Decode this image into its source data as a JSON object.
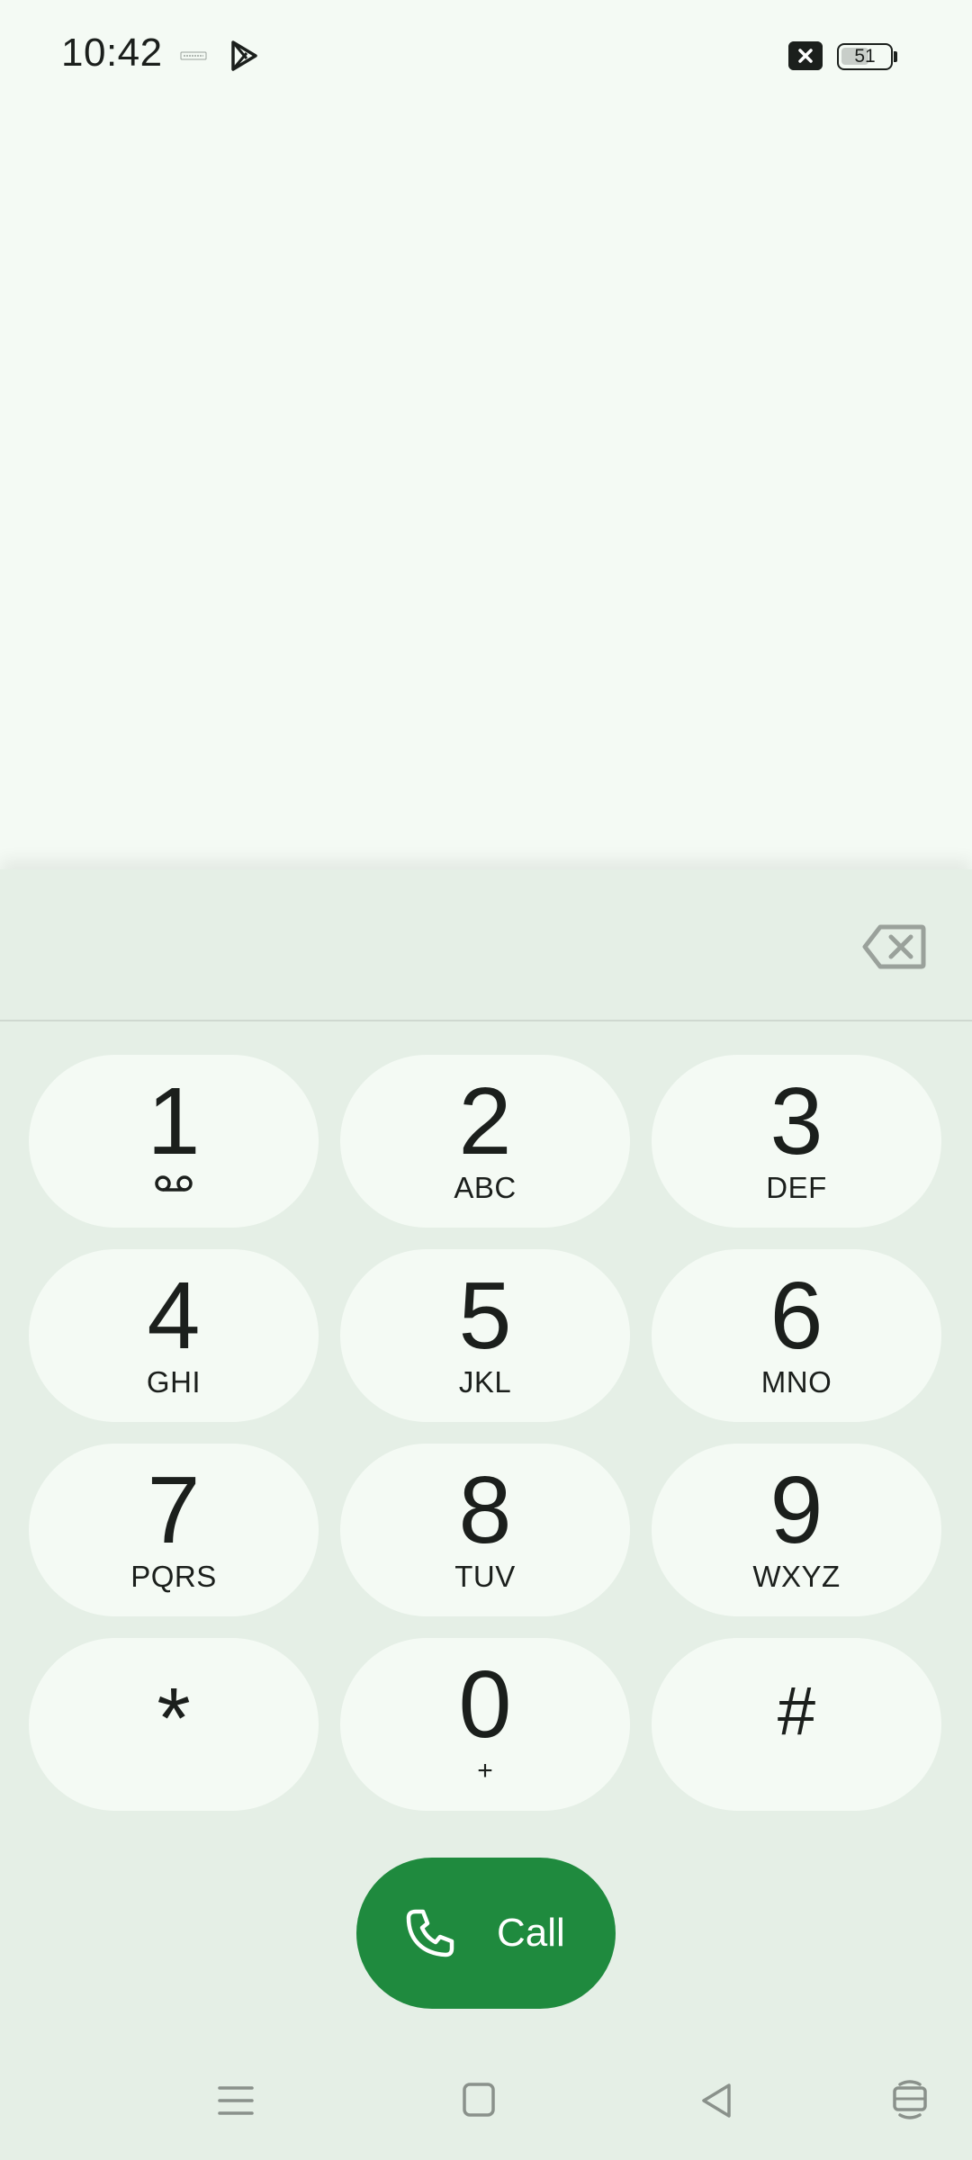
{
  "status_bar": {
    "time": "10:42",
    "battery_level": "51",
    "icons": [
      "notification-icon",
      "play-store-icon",
      "close-badge-icon",
      "battery-icon"
    ]
  },
  "dialer": {
    "digits": "",
    "backspace_icon": "backspace-icon"
  },
  "keypad": {
    "keys": [
      {
        "digit": "1",
        "letters": "",
        "icon": "voicemail-icon"
      },
      {
        "digit": "2",
        "letters": "ABC"
      },
      {
        "digit": "3",
        "letters": "DEF"
      },
      {
        "digit": "4",
        "letters": "GHI"
      },
      {
        "digit": "5",
        "letters": "JKL"
      },
      {
        "digit": "6",
        "letters": "MNO"
      },
      {
        "digit": "7",
        "letters": "PQRS"
      },
      {
        "digit": "8",
        "letters": "TUV"
      },
      {
        "digit": "9",
        "letters": "WXYZ"
      },
      {
        "digit": "*",
        "letters": ""
      },
      {
        "digit": "0",
        "letters": "+"
      },
      {
        "digit": "#",
        "letters": ""
      }
    ]
  },
  "call_button": {
    "label": "Call",
    "icon": "phone-icon",
    "color": "#1f8a3e"
  },
  "nav_bar": {
    "icons": [
      "menu-icon",
      "home-icon",
      "back-icon",
      "rotate-icon"
    ]
  },
  "colors": {
    "background": "#f4faf4",
    "sheet": "#e5efe6",
    "key": "#f4faf4",
    "text": "#1b1f1c"
  }
}
